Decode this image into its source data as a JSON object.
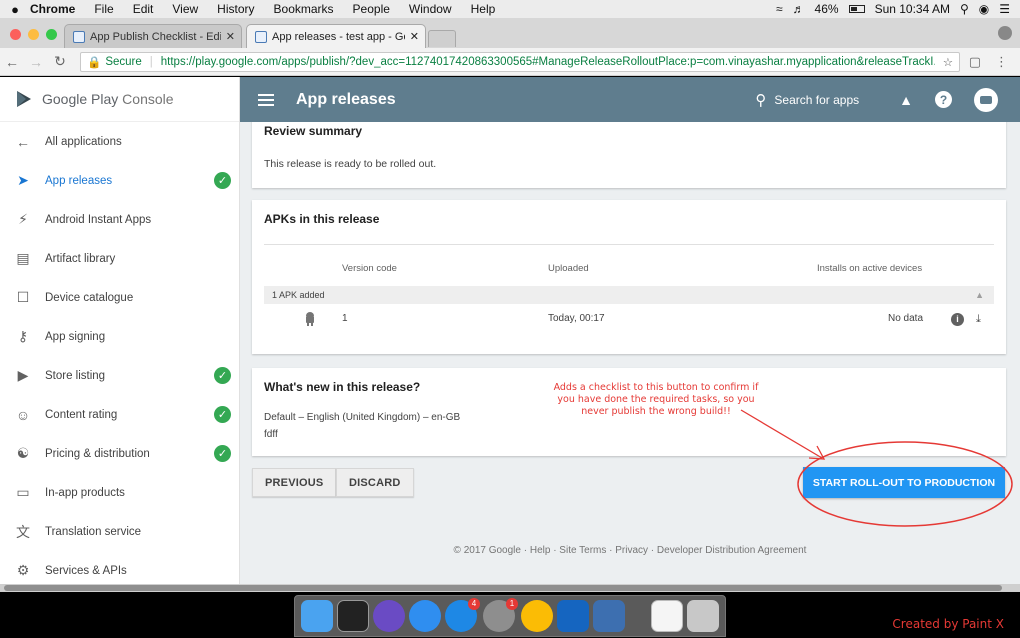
{
  "menubar": {
    "app": "Chrome",
    "items": [
      "File",
      "Edit",
      "View",
      "History",
      "Bookmarks",
      "People",
      "Window",
      "Help"
    ],
    "battery": "46%",
    "clock": "Sun 10:34 AM"
  },
  "tabs": [
    {
      "label": "App Publish Checklist - Edit",
      "active": false
    },
    {
      "label": "App releases - test app - Goo",
      "active": true
    }
  ],
  "address": {
    "secure_label": "Secure",
    "url": "https://play.google.com/apps/publish/?dev_acc=11274017420863300565#ManageReleaseRolloutPlace:p=com.vinayashar.myapplication&releaseTrackI..."
  },
  "console": {
    "brand_main": "Google Play",
    "brand_sub": "Console",
    "page_title": "App releases",
    "search_label": "Search for apps"
  },
  "sidebar": {
    "items": [
      {
        "label": "All applications",
        "icon": "arrow-back-icon",
        "checked": false
      },
      {
        "label": "App releases",
        "icon": "rocket-icon",
        "checked": true,
        "active": true
      },
      {
        "label": "Android Instant Apps",
        "icon": "bolt-icon",
        "checked": false
      },
      {
        "label": "Artifact library",
        "icon": "library-icon",
        "checked": false
      },
      {
        "label": "Device catalogue",
        "icon": "device-icon",
        "checked": false
      },
      {
        "label": "App signing",
        "icon": "key-icon",
        "checked": false
      },
      {
        "label": "Store listing",
        "icon": "store-icon",
        "checked": true
      },
      {
        "label": "Content rating",
        "icon": "rating-icon",
        "checked": true
      },
      {
        "label": "Pricing & distribution",
        "icon": "globe-icon",
        "checked": true
      },
      {
        "label": "In-app products",
        "icon": "card-icon",
        "checked": false
      },
      {
        "label": "Translation service",
        "icon": "translate-icon",
        "checked": false
      },
      {
        "label": "Services & APIs",
        "icon": "api-icon",
        "checked": false
      }
    ]
  },
  "review": {
    "title": "Review summary",
    "text": "This release is ready to be rolled out."
  },
  "apks": {
    "title": "APKs in this release",
    "columns": [
      "Version code",
      "Uploaded",
      "Installs on active devices"
    ],
    "group_label": "1 APK added",
    "rows": [
      {
        "version_code": "1",
        "uploaded": "Today, 00:17",
        "installs": "No data"
      }
    ]
  },
  "whats_new": {
    "title": "What's new in this release?",
    "language": "Default – English (United Kingdom) – en-GB",
    "note": "fdff"
  },
  "annotation": {
    "text": "Adds a checklist to this button to confirm if you have done the required tasks, so you never publish the wrong build!!"
  },
  "buttons": {
    "previous": "PREVIOUS",
    "discard": "DISCARD",
    "rollout": "START ROLL-OUT TO PRODUCTION"
  },
  "footer": {
    "text": "© 2017 Google · Help · Site Terms · Privacy · Developer Distribution Agreement"
  },
  "watermark": "Created by Paint X",
  "colors": {
    "topbar": "#5f7d8e",
    "primary": "#2196f3",
    "check": "#34a853",
    "annotation": "#e53935"
  }
}
